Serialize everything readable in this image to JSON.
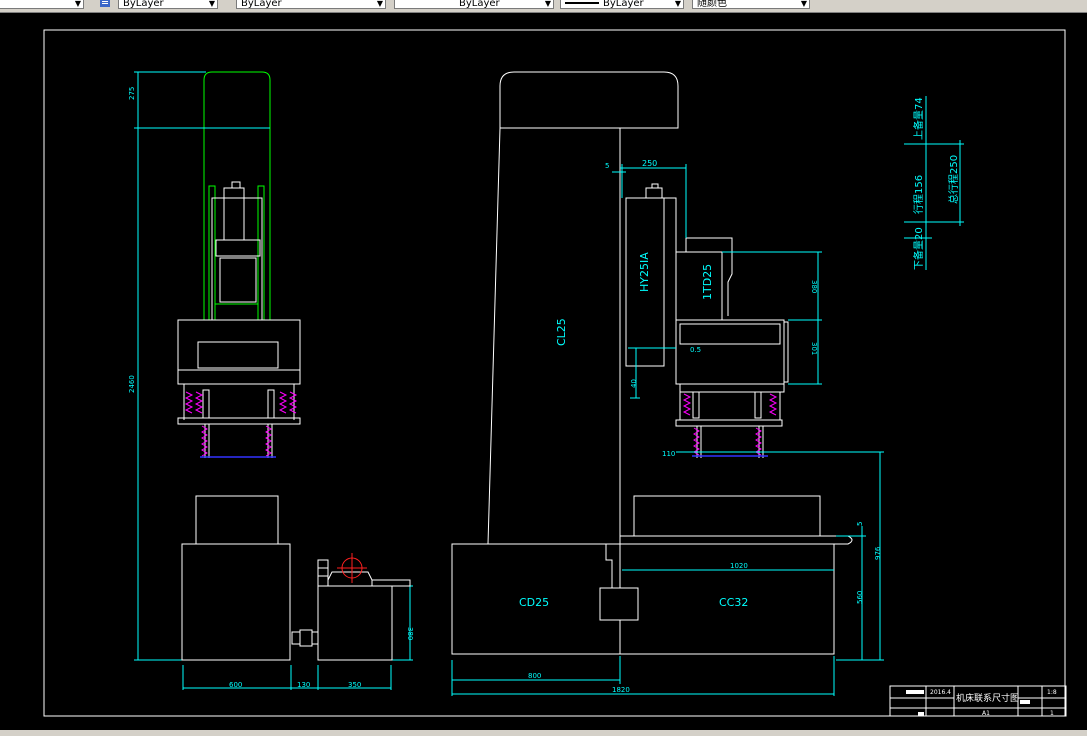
{
  "toolbar": {
    "layer_value": "ByLayer",
    "color_value": "ByLayer",
    "linetype_value": "ByLayer",
    "lineweight_value": "ByLayer",
    "plotstyle_value": "随颜色"
  },
  "colors": {
    "background": "#000000",
    "frame": "#ffffff",
    "dimension": "#00ffff",
    "outline_green": "#00ff00",
    "spring_magenta": "#ff00ff",
    "ref_blue": "#3333ff",
    "pump_red": "#ff2020"
  },
  "icons": {
    "layer_icon": "layer-properties-icon"
  },
  "drawing": {
    "dims_left": {
      "height_total": "2460",
      "top_extension": "275",
      "width_unit": "600",
      "gap": "130",
      "width_pump": "350",
      "height_pump": "380"
    },
    "dims_right": {
      "head_width": "250",
      "head_offset": "5",
      "dim_380": "380",
      "dim_301": "301",
      "dim_0_5": "0.5",
      "dim_40": "40",
      "dim_110": "110",
      "dim_5_right": "5",
      "dim_976": "976",
      "dim_560": "560",
      "dim_1020": "1020",
      "dim_800": "800",
      "dim_1820": "1820"
    },
    "labels": {
      "column": "CL25",
      "head": "HY25IA",
      "head2": "1TD25",
      "base_left": "CD25",
      "base_right": "CC32"
    },
    "stroke_dims": {
      "upper_reserve": "上备量74",
      "stroke": "行程156",
      "total_stroke": "总行程250",
      "lower_reserve": "下备量20"
    },
    "title_block": {
      "date": "2016.4",
      "title": "机床联系尺寸图",
      "scale": "1:8",
      "sheet_size": "A1",
      "sheet_no": "1"
    }
  }
}
